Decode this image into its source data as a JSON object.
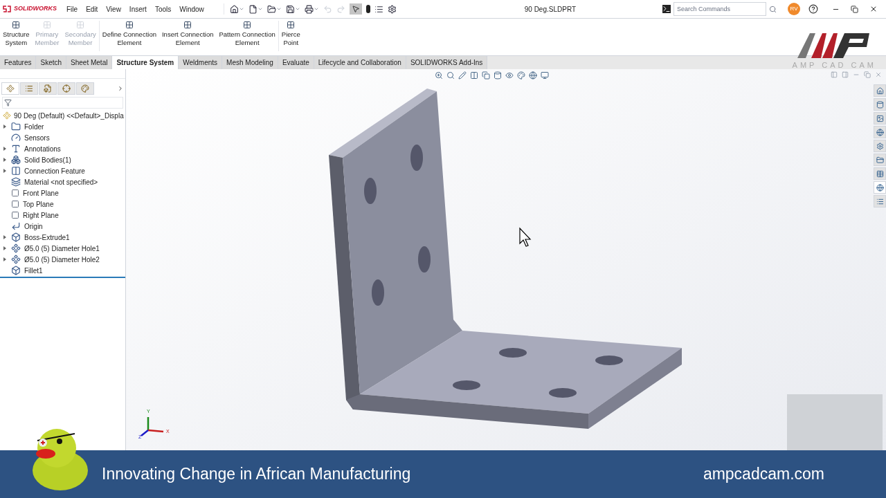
{
  "titlebar": {
    "logo": "SOLIDWORKS",
    "menu": [
      "File",
      "Edit",
      "View",
      "Insert",
      "Tools",
      "Window"
    ],
    "title": "90 Deg.SLDPRT",
    "search": {
      "placeholder": "Search Commands"
    },
    "user": "RV"
  },
  "ribbon": [
    {
      "lines": [
        "Structure",
        "System"
      ],
      "disabled": false
    },
    {
      "lines": [
        "Primary",
        "Member"
      ],
      "disabled": true
    },
    {
      "lines": [
        "Secondary",
        "Member"
      ],
      "disabled": true
    },
    {
      "lines": [
        "Define Connection",
        "Element"
      ],
      "disabled": false
    },
    {
      "lines": [
        "Insert Connection",
        "Element"
      ],
      "disabled": false
    },
    {
      "lines": [
        "Pattern Connection",
        "Element"
      ],
      "disabled": false
    },
    {
      "lines": [
        "Pierce",
        "Point"
      ],
      "disabled": false
    }
  ],
  "tabs": [
    {
      "label": "Features",
      "selected": false
    },
    {
      "label": "Sketch",
      "selected": false
    },
    {
      "label": "Sheet Metal",
      "selected": false
    },
    {
      "label": "Structure System",
      "selected": true
    },
    {
      "label": "Weldments",
      "selected": false
    },
    {
      "label": "Mesh Modeling",
      "selected": false
    },
    {
      "label": "Evaluate",
      "selected": false
    },
    {
      "label": "Lifecycle and Collaboration",
      "selected": false
    },
    {
      "label": "SOLIDWORKS Add-Ins",
      "selected": false
    }
  ],
  "tree": {
    "root": "90 Deg (Default) <<Default>_Displa",
    "items": [
      {
        "label": "Folder",
        "kind": "folder",
        "expander": true
      },
      {
        "label": "Sensors",
        "kind": "sensor",
        "expander": false
      },
      {
        "label": "Annotations",
        "kind": "annotation",
        "expander": true
      },
      {
        "label": "Solid Bodies(1)",
        "kind": "bodies",
        "expander": true
      },
      {
        "label": "Connection Feature",
        "kind": "connection",
        "expander": true
      },
      {
        "label": "Material <not specified>",
        "kind": "material",
        "expander": false
      },
      {
        "label": "Front Plane",
        "kind": "plane",
        "expander": false
      },
      {
        "label": "Top Plane",
        "kind": "plane",
        "expander": false
      },
      {
        "label": "Right Plane",
        "kind": "plane",
        "expander": false
      },
      {
        "label": "Origin",
        "kind": "origin",
        "expander": false
      },
      {
        "label": "Boss-Extrude1",
        "kind": "feature",
        "expander": true
      },
      {
        "label": "Ø5.0 (5) Diameter Hole1",
        "kind": "hole",
        "expander": true
      },
      {
        "label": "Ø5.0 (5) Diameter Hole2",
        "kind": "hole",
        "expander": true
      },
      {
        "label": "Fillet1",
        "kind": "feature",
        "expander": false
      }
    ]
  },
  "manager_tabs": [
    {
      "selected": true
    },
    {
      "selected": false
    },
    {
      "selected": false
    },
    {
      "selected": false
    },
    {
      "selected": false
    }
  ],
  "task_pane": [
    {
      "selected": false
    },
    {
      "selected": false
    },
    {
      "selected": false
    },
    {
      "selected": false
    },
    {
      "selected": false
    },
    {
      "selected": false
    },
    {
      "selected": false
    },
    {
      "selected": true
    },
    {
      "selected": false
    }
  ],
  "overlay_logo": {
    "caption": "AMP CAD CAM"
  },
  "triad": {
    "x": "X",
    "y": "Y",
    "z": "Z"
  },
  "banner": {
    "tagline": "Innovating Change in African Manufacturing",
    "website": "ampcadcam.com"
  }
}
